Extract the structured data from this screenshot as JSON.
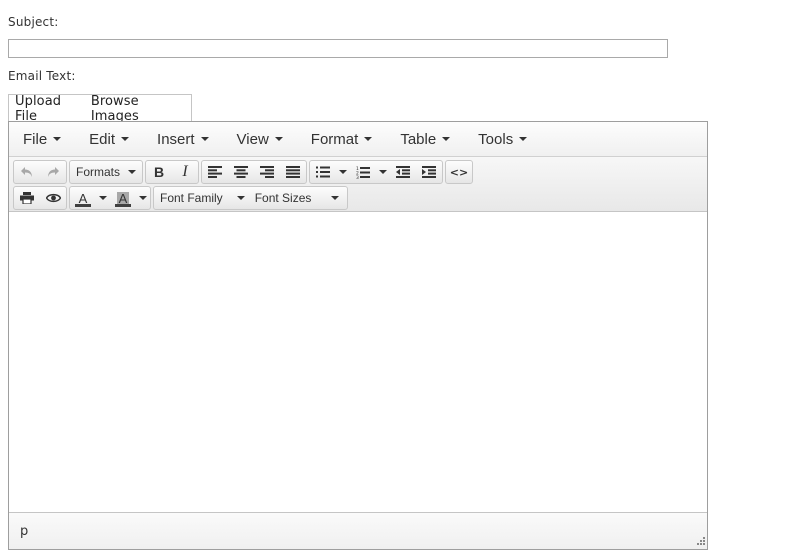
{
  "form": {
    "subject_label": "Subject:",
    "subject_value": "",
    "email_text_label": "Email Text:"
  },
  "upload_bar": {
    "upload_file": "Upload File",
    "browse_images": "Browse Images"
  },
  "menubar": {
    "items": [
      "File",
      "Edit",
      "Insert",
      "View",
      "Format",
      "Table",
      "Tools"
    ]
  },
  "toolbar": {
    "formats_label": "Formats",
    "bold_label": "B",
    "italic_label": "I",
    "font_family_label": "Font Family",
    "font_sizes_label": "Font Sizes",
    "text_color_letter": "A",
    "bg_color_letter": "A",
    "text_color": "#404040",
    "bg_color_highlight": "#a8a8a8"
  },
  "statusbar": {
    "path": "p"
  },
  "icons": {
    "undo": "undo-icon",
    "redo": "redo-icon",
    "align_left": "align-left-icon",
    "align_center": "align-center-icon",
    "align_right": "align-right-icon",
    "align_justify": "align-justify-icon",
    "bullet_list": "bullet-list-icon",
    "numbered_list": "numbered-list-icon",
    "outdent": "outdent-icon",
    "indent": "indent-icon",
    "code": "code-icon",
    "print": "print-icon",
    "preview": "eye-icon",
    "resize": "resize-handle-icon"
  }
}
